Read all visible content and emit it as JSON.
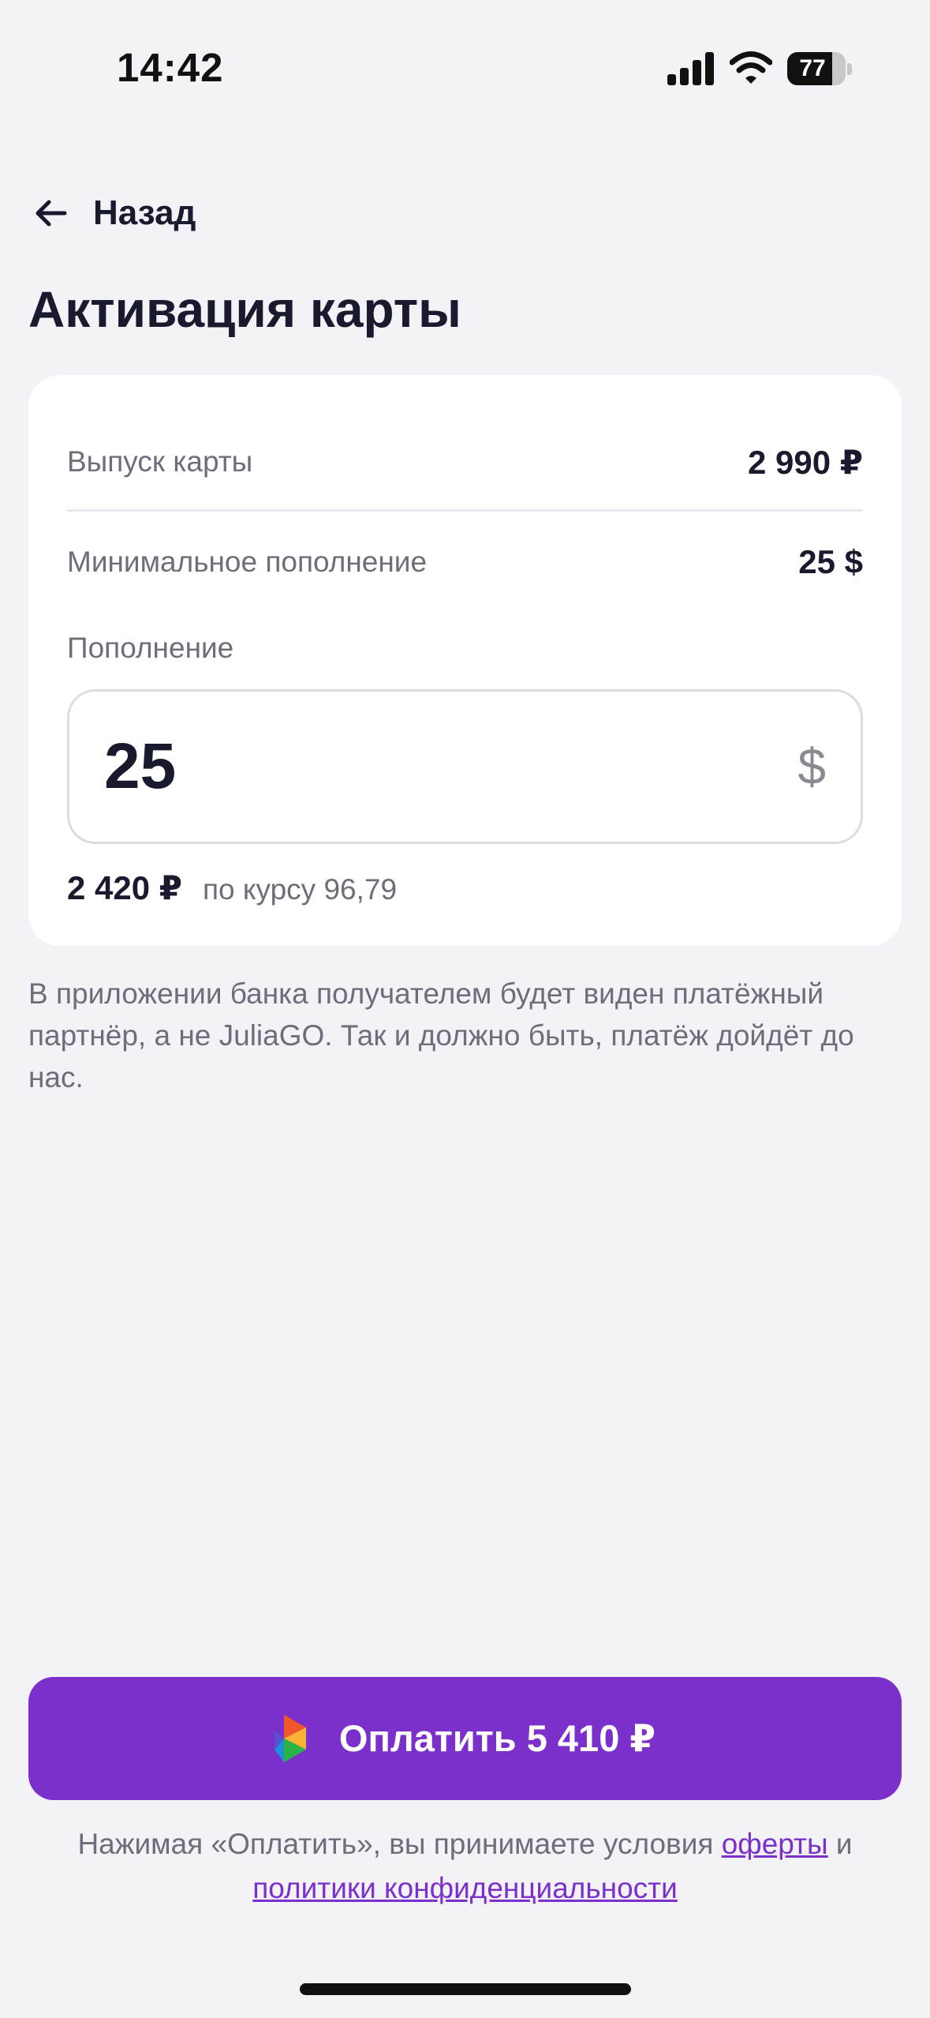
{
  "status_bar": {
    "time": "14:42",
    "battery_percent": "77",
    "battery_level": 0.77
  },
  "nav": {
    "back_label": "Назад"
  },
  "page_title": "Активация карты",
  "card": {
    "issue_label": "Выпуск карты",
    "issue_value": "2 990 ₽",
    "min_topup_label": "Минимальное пополнение",
    "min_topup_value": "25 $",
    "topup_label": "Пополнение",
    "topup_amount": "25",
    "topup_currency": "$",
    "converted_amount": "2 420 ₽",
    "rate_text": "по курсу 96,79"
  },
  "info_text": "В приложении банка получателем будет виден платёжный партнёр, а не JuliaGO. Так и должно быть, платёж дойдёт до нас.",
  "pay_button": {
    "label": "Оплатить 5 410 ₽"
  },
  "legal": {
    "prefix": "Нажимая «Оплатить», вы принимаете условия",
    "offer_link": "оферты",
    "conjunction": "и",
    "privacy_link": "политики конфиденциальности"
  },
  "colors": {
    "accent": "#7b30cc",
    "background": "#f2f2f7",
    "card": "#ffffff",
    "text": "#1a1a2e",
    "muted": "#6e6e7a"
  },
  "icons": [
    "signal-icon",
    "wifi-icon",
    "battery-icon",
    "back-arrow-icon",
    "payment-logo-icon"
  ]
}
